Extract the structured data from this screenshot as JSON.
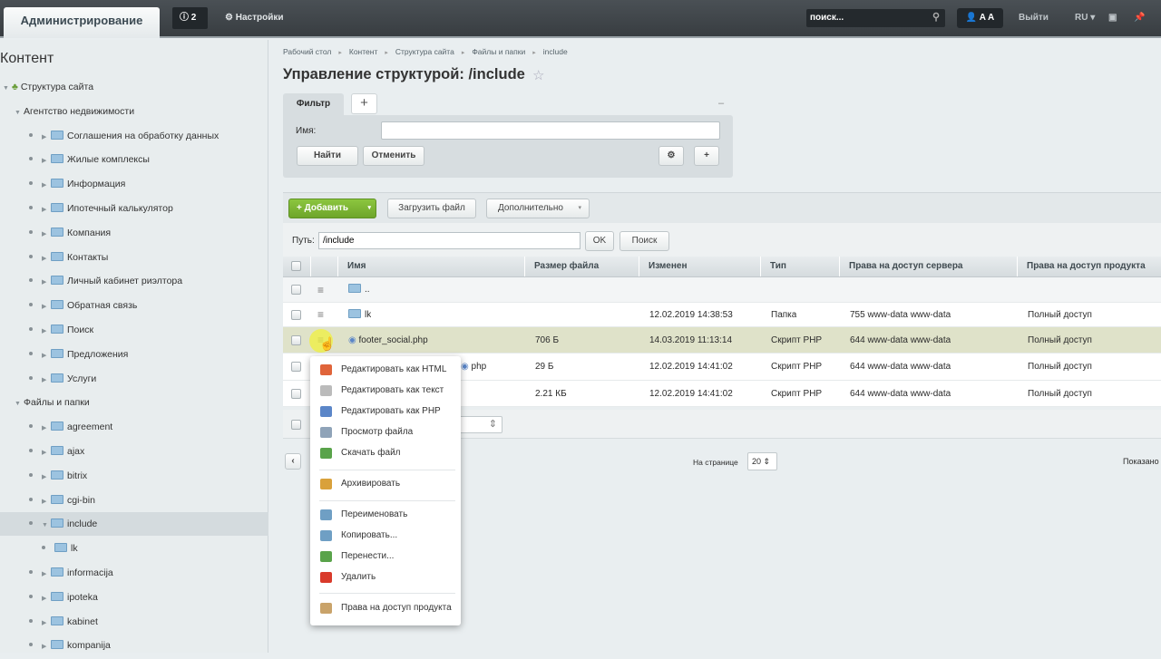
{
  "topbar": {
    "admin_tab": "Администрирование",
    "notifications": "2",
    "settings": "Настройки",
    "search_placeholder": "поиск...",
    "user": "A A",
    "logout": "Выйти",
    "lang": "RU"
  },
  "sidebar": {
    "title": "Контент",
    "items": [
      {
        "label": "Структура сайта",
        "level": 0,
        "type": "root"
      },
      {
        "label": "Агентство недвижимости",
        "level": 1,
        "type": "open"
      },
      {
        "label": "Соглашения на обработку данных",
        "level": 2,
        "type": "folder"
      },
      {
        "label": "Жилые комплексы",
        "level": 2,
        "type": "folder"
      },
      {
        "label": "Информация",
        "level": 2,
        "type": "folder"
      },
      {
        "label": "Ипотечный калькулятор",
        "level": 2,
        "type": "folder"
      },
      {
        "label": "Компания",
        "level": 2,
        "type": "folder"
      },
      {
        "label": "Контакты",
        "level": 2,
        "type": "folder"
      },
      {
        "label": "Личный кабинет риэлтора",
        "level": 2,
        "type": "folder"
      },
      {
        "label": "Обратная связь",
        "level": 2,
        "type": "folder"
      },
      {
        "label": "Поиск",
        "level": 2,
        "type": "folder"
      },
      {
        "label": "Предложения",
        "level": 2,
        "type": "folder"
      },
      {
        "label": "Услуги",
        "level": 2,
        "type": "folder"
      },
      {
        "label": "Файлы и папки",
        "level": 1,
        "type": "open"
      },
      {
        "label": "agreement",
        "level": 2,
        "type": "folder"
      },
      {
        "label": "ajax",
        "level": 2,
        "type": "folder"
      },
      {
        "label": "bitrix",
        "level": 2,
        "type": "folder"
      },
      {
        "label": "cgi-bin",
        "level": 2,
        "type": "folder"
      },
      {
        "label": "include",
        "level": 2,
        "type": "folder-open",
        "selected": true
      },
      {
        "label": "lk",
        "level": 3,
        "type": "leaf"
      },
      {
        "label": "informacija",
        "level": 2,
        "type": "folder"
      },
      {
        "label": "ipoteka",
        "level": 2,
        "type": "folder"
      },
      {
        "label": "kabinet",
        "level": 2,
        "type": "folder"
      },
      {
        "label": "kompanija",
        "level": 2,
        "type": "folder"
      }
    ]
  },
  "breadcrumb": [
    "Рабочий стол",
    "Контент",
    "Структура сайта",
    "Файлы и папки",
    "include"
  ],
  "page_title": "Управление структурой: /include",
  "filter": {
    "tab": "Фильтр",
    "name_label": "Имя:",
    "name_value": "",
    "find": "Найти",
    "cancel": "Отменить"
  },
  "toolbar": {
    "add": "Добавить",
    "upload": "Загрузить файл",
    "more": "Дополнительно"
  },
  "path": {
    "label": "Путь:",
    "value": "/include",
    "ok": "OK",
    "search": "Поиск"
  },
  "table": {
    "headers": [
      "Имя",
      "Размер файла",
      "Изменен",
      "Тип",
      "Права на доступ сервера",
      "Права на доступ продукта"
    ],
    "rows": [
      {
        "name": "..",
        "size": "",
        "changed": "",
        "type": "",
        "server": "",
        "product": "",
        "icon": "folder-up"
      },
      {
        "name": "lk",
        "size": "",
        "changed": "12.02.2019 14:38:53",
        "type": "Папка",
        "server": "755 www-data www-data",
        "product": "Полный доступ",
        "icon": "folder"
      },
      {
        "name": "footer_social.php",
        "size": "706 Б",
        "changed": "14.03.2019 11:13:14",
        "type": "Скрипт PHP",
        "server": "644 www-data www-data",
        "product": "Полный доступ",
        "icon": "php",
        "highlight": true
      },
      {
        "name": "php",
        "size": "29 Б",
        "changed": "12.02.2019 14:41:02",
        "type": "Скрипт PHP",
        "server": "644 www-data www-data",
        "product": "Полный доступ",
        "icon": "php"
      },
      {
        "name": "",
        "size": "2.21 КБ",
        "changed": "12.02.2019 14:41:02",
        "type": "Скрипт PHP",
        "server": "644 www-data www-data",
        "product": "Полный доступ",
        "icon": "php"
      }
    ]
  },
  "pager": {
    "per_page_label": "На странице",
    "per_page": "20",
    "shown": "Показано"
  },
  "context_menu": [
    {
      "label": "Редактировать как HTML",
      "color": "#e0643a"
    },
    {
      "label": "Редактировать как текст",
      "color": "#bbbbbb"
    },
    {
      "label": "Редактировать как PHP",
      "color": "#5b86c8"
    },
    {
      "label": "Просмотр файла",
      "color": "#8fa3b8"
    },
    {
      "label": "Скачать файл",
      "color": "#59a34a"
    },
    {
      "label": "Архивировать",
      "color": "#d9a13b"
    },
    {
      "label": "Переименовать",
      "color": "#6f9fc4"
    },
    {
      "label": "Копировать...",
      "color": "#6f9fc4"
    },
    {
      "label": "Перенести...",
      "color": "#59a34a"
    },
    {
      "label": "Удалить",
      "color": "#d93a2b"
    },
    {
      "label": "Права на доступ продукта",
      "color": "#c9a36a"
    }
  ]
}
